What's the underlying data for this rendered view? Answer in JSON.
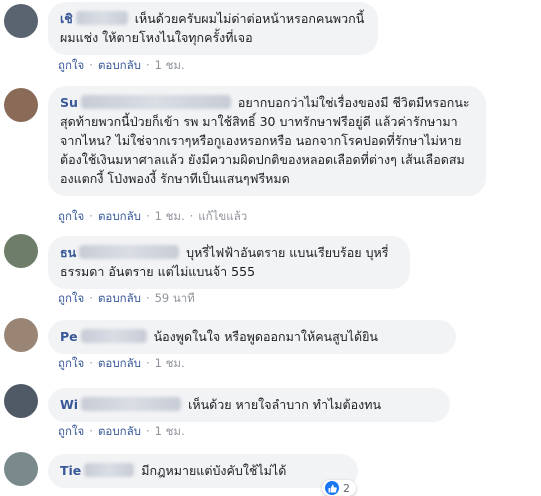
{
  "comments": [
    {
      "name_visible": "เชิ",
      "text": "เห็นด้วยครับผมไม่ด่าต่อหน้าหรอกคนพวกนี้ผมแช่ง ให้ตายโหงไนใจทุกครั้งที่เจอ",
      "actions": {
        "like": "ถูกใจ",
        "reply": "ตอบกลับ",
        "time": "1 ชม."
      }
    },
    {
      "name_visible": "Su",
      "text": "อยากบอกว่าไม่ใช่เรื่องของมี ชีวิตมีหรอกนะ สุดท้ายพวกนี้ป่วยก็เข้า รพ มาใช้สิทธิ์ 30 บาทรักษาฟรีอยู่ดี แล้วค่ารักษามาจากไหน? ไม่ใช่จากเราๆหรือกูเองหรอกหรือ นอกจากโรคปอดที่รักษาไม่หายต้องใช้เงินมหาศาลแล้ว ยังมีความผิดปกติของหลอดเลือดที่ต่างๆ เส้นเลือดสมองแตกงี้ โป่งพองงี้ รักษาทีเป็นแสนๆฟรีหมด",
      "actions": {
        "like": "ถูกใจ",
        "reply": "ตอบกลับ",
        "time": "1 ชม.",
        "edited": "แก้ไขแล้ว"
      }
    },
    {
      "name_visible": "ธน",
      "text": "บุหรี่ไฟฟ้าอันตราย แบนเรียบร้อย บุหรี่ธรรมดา อันตราย แต่ไม่แบนจ้า 555",
      "actions": {
        "like": "ถูกใจ",
        "reply": "ตอบกลับ",
        "time": "59 นาที"
      }
    },
    {
      "name_visible": "Pe",
      "text": "น้องพูดในใจ หรือพูดออกมาให้คนสูบได้ยิน",
      "actions": {
        "like": "ถูกใจ",
        "reply": "ตอบกลับ",
        "time": "1 ชม."
      }
    },
    {
      "name_visible": "Wi",
      "text": "เห็นด้วย หายใจลำบาก ทำไมต้องทน",
      "actions": {
        "like": "ถูกใจ",
        "reply": "ตอบกลับ",
        "time": "1 ชม."
      }
    },
    {
      "name_visible": "Tie",
      "text": "มีกฎหมายแต่บังคับใช้ไม่ได้",
      "reaction_count": "2"
    }
  ],
  "colors": {
    "name": "#385898",
    "bubble": "#f2f3f5",
    "like": "#1877f2"
  },
  "icons": {
    "reaction": "thumbs-up-icon"
  }
}
